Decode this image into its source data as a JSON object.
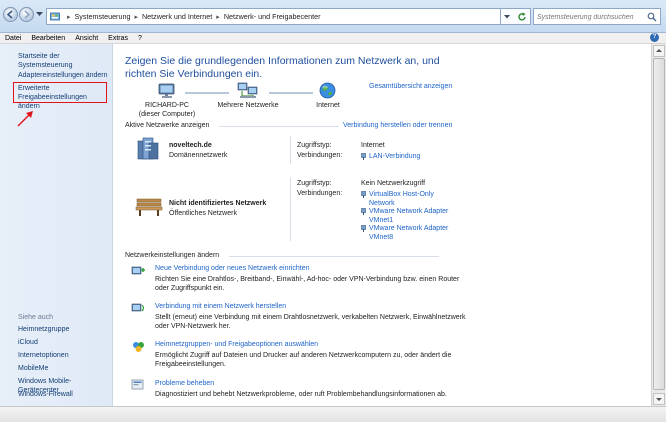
{
  "address": {
    "breadcrumbs": [
      "Systemsteuerung",
      "Netzwerk und Internet",
      "Netzwerk- und Freigabecenter"
    ],
    "search_placeholder": "Systemsteuerung durchsuchen"
  },
  "menu": {
    "items": [
      "Datei",
      "Bearbeiten",
      "Ansicht",
      "Extras",
      "?"
    ]
  },
  "sidebar": {
    "items": [
      {
        "label": "Startseite der Systemsteuerung"
      },
      {
        "label": "Adaptereinstellungen ändern"
      },
      {
        "label": "Erweiterte Freigabeeinstellungen ändern"
      }
    ],
    "see_also_label": "Siehe auch",
    "see_also": [
      "Heimnetzgruppe",
      "iCloud",
      "Internetoptionen",
      "MobileMe",
      "Windows Mobile-Gerätecenter",
      "Windows-Firewall"
    ]
  },
  "main": {
    "heading": "Zeigen Sie die grundlegenden Informationen zum Netzwerk an, und richten Sie Verbindungen ein.",
    "full_map_link": "Gesamtübersicht anzeigen",
    "map": {
      "computer_name": "RICHARD-PC",
      "computer_sub": "(dieser Computer)",
      "networks": "Mehrere Netzwerke",
      "internet": "Internet"
    },
    "active_networks_label": "Aktive Netzwerke anzeigen",
    "connect_disconnect_link": "Verbindung herstellen oder trennen",
    "networks": [
      {
        "name": "noveltech.de",
        "type": "Domänennetzwerk",
        "access_label": "Zugriffstyp:",
        "access_value": "Internet",
        "connections_label": "Verbindungen:",
        "connections": [
          "LAN-Verbindung"
        ]
      },
      {
        "name": "Nicht identifiziertes Netzwerk",
        "type": "Öffentliches Netzwerk",
        "access_label": "Zugriffstyp:",
        "access_value": "Kein Netzwerkzugriff",
        "connections_label": "Verbindungen:",
        "connections": [
          "VirtualBox Host-Only Network",
          "VMware Network Adapter VMnet1",
          "VMware Network Adapter VMnet8"
        ]
      }
    ],
    "settings_label": "Netzwerkeinstellungen ändern",
    "tasks": [
      {
        "link": "Neue Verbindung oder neues Netzwerk einrichten",
        "desc": "Richten Sie eine Drahtlos-, Breitband-, Einwähl-, Ad-hoc- oder VPN-Verbindung bzw. einen Router oder Zugriffspunkt ein."
      },
      {
        "link": "Verbindung mit einem Netzwerk herstellen",
        "desc": "Stellt (erneut) eine Verbindung mit einem Drahtlosnetzwerk, verkabelten Netzwerk, Einwählnetzwerk oder VPN-Netzwerk her."
      },
      {
        "link": "Heimnetzgruppen- und Freigabeoptionen auswählen",
        "desc": "Ermöglicht Zugriff auf Dateien und Drucker auf anderen Netzwerkcomputern zu, oder ändert die Freigabeeinstellungen."
      },
      {
        "link": "Probleme beheben",
        "desc": "Diagnostiziert und behebt Netzwerkprobleme, oder ruft Problembehandlungsinformationen ab."
      }
    ]
  },
  "colors": {
    "heading": "#1f4e9c",
    "link": "#1e64c8",
    "highlight_box": "#e0151c"
  }
}
